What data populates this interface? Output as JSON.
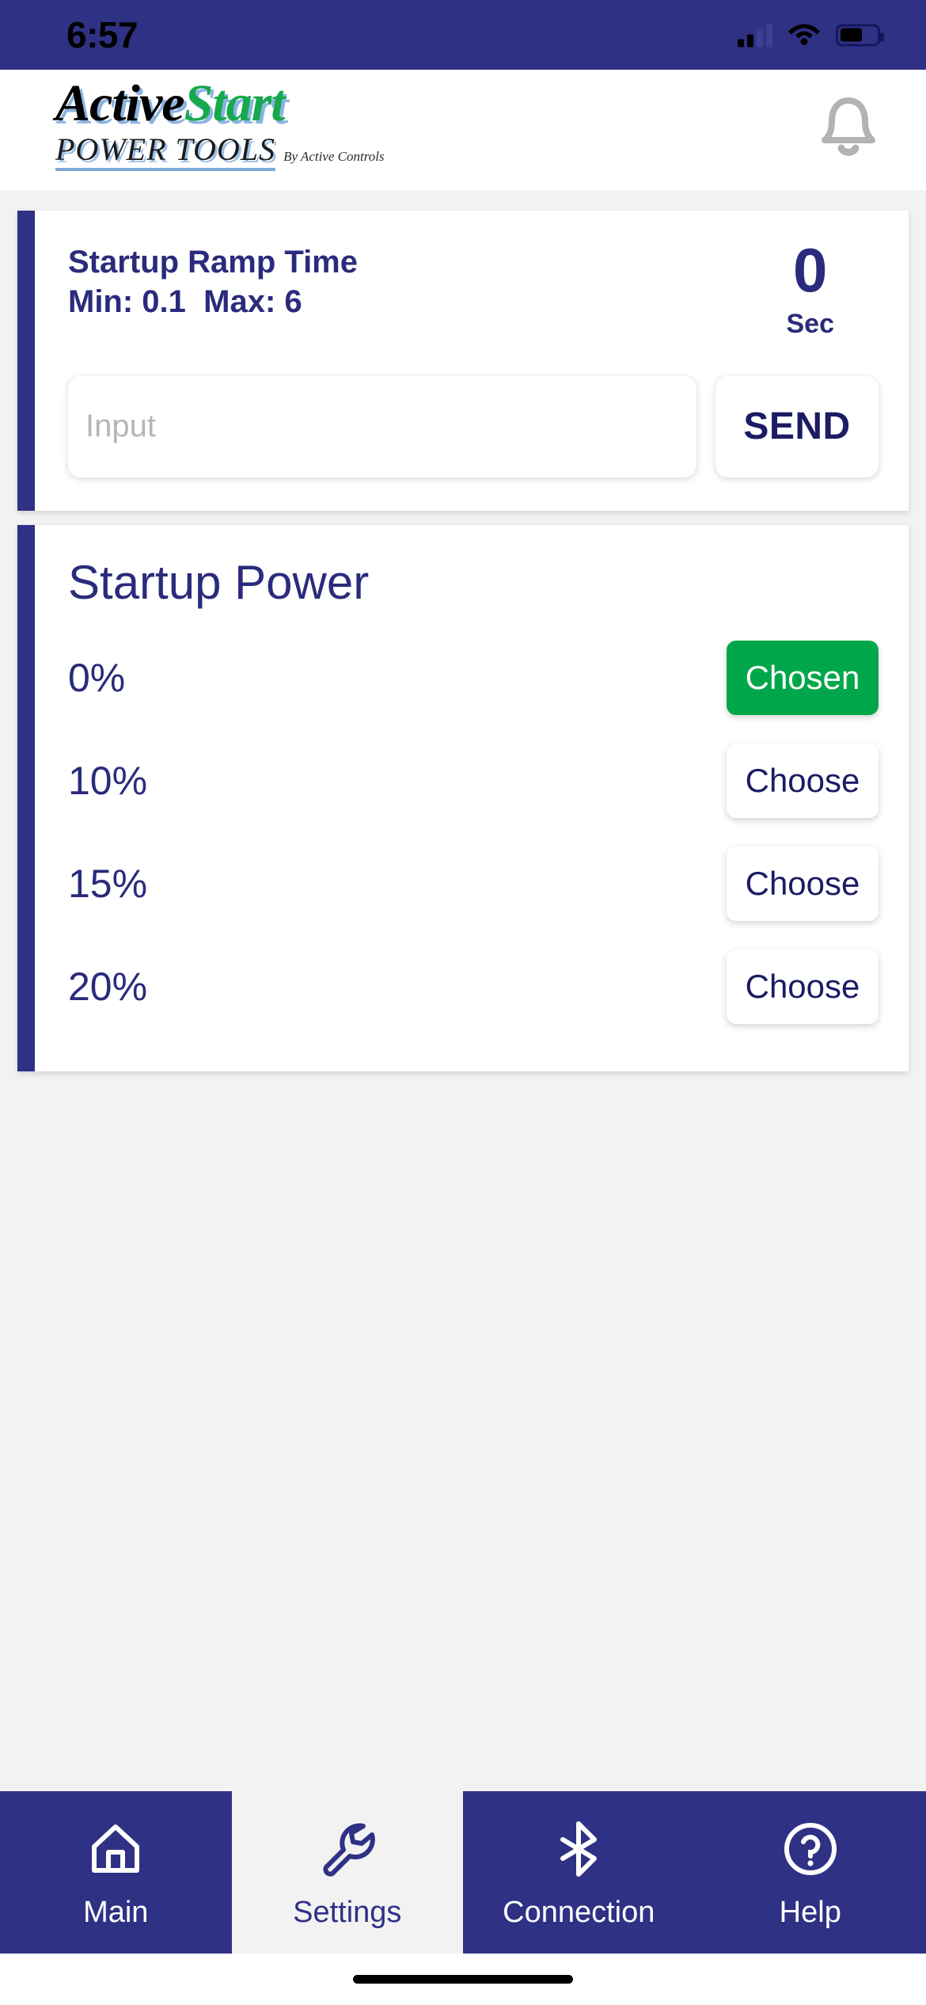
{
  "status_bar": {
    "time": "6:57",
    "signal_icon": "signal-bars-icon",
    "wifi_icon": "wifi-icon",
    "battery_icon": "battery-icon"
  },
  "header": {
    "brand_part1": "Active",
    "brand_part2": "Start",
    "brand_subtitle": "POWER TOOLS",
    "byline": "By Active Controls",
    "notification_icon": "bell-icon",
    "colors": {
      "brand_black": "#000000",
      "brand_green": "#17a94d",
      "brand_shadow": "#8ab4e0"
    }
  },
  "ramp_card": {
    "title": "Startup Ramp Time",
    "range": "Min: 0.1  Max: 6",
    "value": "0",
    "unit": "Sec",
    "input_placeholder": "Input",
    "send_label": "SEND"
  },
  "power_card": {
    "title": "Startup Power",
    "rows": [
      {
        "percent": "0%",
        "button": "Chosen",
        "state": "chosen"
      },
      {
        "percent": "10%",
        "button": "Choose",
        "state": "choose"
      },
      {
        "percent": "15%",
        "button": "Choose",
        "state": "choose"
      },
      {
        "percent": "20%",
        "button": "Choose",
        "state": "choose"
      }
    ],
    "chosen_color": "#00a74a"
  },
  "bottom_nav": {
    "items": [
      {
        "label": "Main",
        "icon": "home-icon",
        "active": false
      },
      {
        "label": "Settings",
        "icon": "wrench-icon",
        "active": true
      },
      {
        "label": "Connection",
        "icon": "bluetooth-icon",
        "active": false
      },
      {
        "label": "Help",
        "icon": "help-circle-icon",
        "active": false
      }
    ],
    "accent_color": "#2f3185"
  }
}
